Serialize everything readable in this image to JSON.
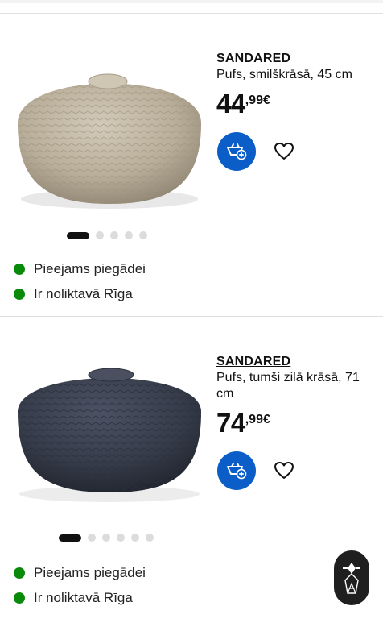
{
  "products": [
    {
      "name": "SANDARED",
      "description": "Pufs, smilškrāsā, 45 cm",
      "price_int": "44",
      "price_dec": ",99€",
      "color": "#c4b9a6",
      "carousel": {
        "count": 5,
        "active": 0
      },
      "availability": [
        {
          "text": "Pieejams piegādei",
          "status_color": "#0a8a0a"
        },
        {
          "text": "Ir noliktavā Rīga",
          "status_color": "#0a8a0a"
        }
      ]
    },
    {
      "name": "SANDARED",
      "description": "Pufs, tumši zilā krāsā, 71 cm",
      "price_int": "74",
      "price_dec": ",99€",
      "color": "#3a4150",
      "carousel": {
        "count": 6,
        "active": 0
      },
      "availability": [
        {
          "text": "Pieejams piegādei",
          "status_color": "#0a8a0a"
        },
        {
          "text": "Ir noliktavā Rīga",
          "status_color": "#0a8a0a"
        }
      ]
    }
  ],
  "buttons": {
    "add_to_cart_icon": "add-to-cart-icon",
    "wishlist_icon": "heart-icon"
  },
  "fab_icon": "chat-assistant-icon",
  "colors": {
    "primary": "#0058a3",
    "available": "#0a8a0a",
    "text": "#111111"
  }
}
